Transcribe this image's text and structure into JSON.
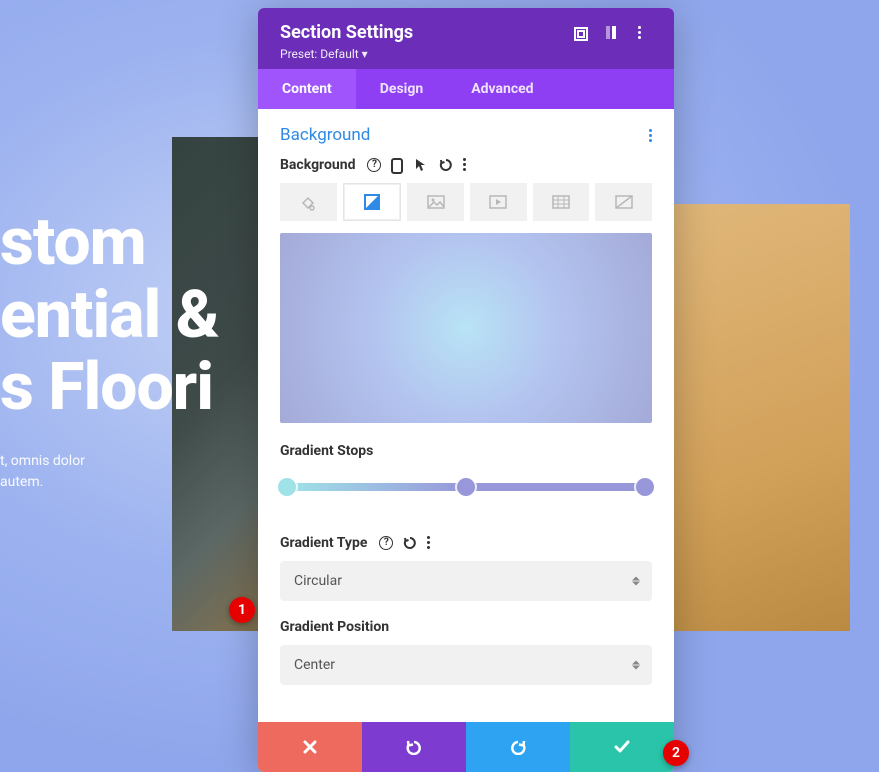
{
  "hero": {
    "line1": "stom",
    "line2": "ential &",
    "line3": "s Floori",
    "sub1": "t, omnis dolor",
    "sub2": "autem."
  },
  "modal": {
    "title": "Section Settings",
    "preset_label": "Preset:",
    "preset_value": "Default"
  },
  "tabs": {
    "content": "Content",
    "design": "Design",
    "advanced": "Advanced"
  },
  "panel": {
    "heading": "Background",
    "bg_label": "Background",
    "bg_tab_icons": [
      "fill-icon",
      "gradient-icon",
      "image-icon",
      "video-icon",
      "pattern-icon",
      "mask-icon"
    ],
    "gradient_stops_label": "Gradient Stops",
    "stops": [
      {
        "pos": 2,
        "color": "#9fe2e8"
      },
      {
        "pos": 50,
        "color": "#9897d9"
      },
      {
        "pos": 98,
        "color": "#9897d9"
      }
    ],
    "gradient_type_label": "Gradient Type",
    "gradient_type_value": "Circular",
    "gradient_position_label": "Gradient Position",
    "gradient_position_value": "Center"
  },
  "annotations": {
    "badge1": "1",
    "badge2": "2"
  },
  "chart_data": {
    "type": "table",
    "title": "Section Settings — Background gradient",
    "fields": [
      {
        "name": "Gradient Type",
        "value": "Circular"
      },
      {
        "name": "Gradient Position",
        "value": "Center"
      }
    ],
    "gradient_stops": [
      {
        "position_pct": 0,
        "color": "#9fe2e8"
      },
      {
        "position_pct": 50,
        "color": "#9897d9"
      },
      {
        "position_pct": 100,
        "color": "#9897d9"
      }
    ]
  }
}
